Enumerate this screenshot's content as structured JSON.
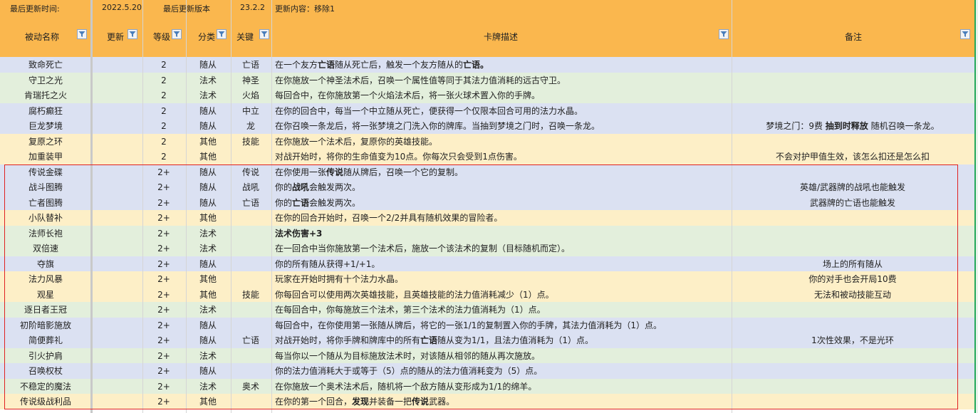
{
  "info": {
    "last_update_label": "最后更新时间:",
    "last_update_date": "2022.5.20",
    "last_version_label": "最后更新版本",
    "version": "23.2.2",
    "update_content": "更新内容：移除1"
  },
  "headers": {
    "name": "被动名称",
    "updated": "更新",
    "level": "等级",
    "category": "分类",
    "keyword": "关键",
    "description": "卡牌描述",
    "notes": "备注"
  },
  "colors": {
    "header": "#fab74e",
    "blue_row": "#dbe1f2",
    "green_row": "#e3efdc",
    "yellow_row": "#fdefc7",
    "highlight_border": "#e02020",
    "filter_icon": "#4a7ebb"
  },
  "rows": [
    {
      "name": "致命死亡",
      "level": "2",
      "category": "随从",
      "keyword": "亡语",
      "color": "blue",
      "desc": [
        [
          "在一个友方",
          false
        ],
        [
          "亡语",
          true
        ],
        [
          "随从死亡后，触发一个友方随从的",
          false
        ],
        [
          "亡语。",
          true
        ]
      ],
      "note": ""
    },
    {
      "name": "守卫之光",
      "level": "2",
      "category": "法术",
      "keyword": "神圣",
      "color": "green",
      "desc": [
        [
          "在你施放一个神圣法术后，召唤一个属性值等同于其法力值消耗的远古守卫。",
          false
        ]
      ],
      "note": ""
    },
    {
      "name": "肯瑞托之火",
      "level": "2",
      "category": "法术",
      "keyword": "火焰",
      "color": "green",
      "desc": [
        [
          "每回合中，在你施放第一个火焰法术后，将一张火球术置入你的手牌。",
          false
        ]
      ],
      "note": ""
    },
    {
      "name": "腐朽癫狂",
      "level": "2",
      "category": "随从",
      "keyword": "中立",
      "color": "blue",
      "desc": [
        [
          "在你的回合中，每当一个中立随从死亡，便获得一个仅限本回合可用的法力水晶。",
          false
        ]
      ],
      "note": ""
    },
    {
      "name": "巨龙梦境",
      "level": "2",
      "category": "随从",
      "keyword": "龙",
      "color": "blue",
      "desc": [
        [
          "在你召唤一条龙后，将一张梦境之门洗入你的牌库。当抽到梦境之门时，召唤一条龙。",
          false
        ]
      ],
      "note": [
        [
          "梦境之门：9费 ",
          false
        ],
        [
          "抽到时释放",
          true
        ],
        [
          " 随机召唤一条龙。",
          false
        ]
      ]
    },
    {
      "name": "复原之环",
      "level": "2",
      "category": "其他",
      "keyword": "技能",
      "color": "yellow",
      "desc": [
        [
          "在你施放一个法术后，复原你的英雄技能。",
          false
        ]
      ],
      "note": ""
    },
    {
      "name": "加重装甲",
      "level": "2",
      "category": "其他",
      "keyword": "",
      "color": "yellow",
      "desc": [
        [
          "对战开始时，将你的生命值变为10点。你每次只会受到1点伤害。",
          false
        ]
      ],
      "note": "不会对护甲值生效，该怎么扣还是怎么扣"
    },
    {
      "name": "传说金碟",
      "level": "2+",
      "category": "随从",
      "keyword": "传说",
      "color": "blue",
      "desc": [
        [
          "在你使用一张",
          false
        ],
        [
          "传说",
          true
        ],
        [
          "随从牌后，召唤一个它的复制。",
          false
        ]
      ],
      "note": ""
    },
    {
      "name": "战斗图腾",
      "level": "2+",
      "category": "随从",
      "keyword": "战吼",
      "color": "blue",
      "desc": [
        [
          "你的",
          false
        ],
        [
          "战吼",
          true
        ],
        [
          "会触发两次。",
          false
        ]
      ],
      "note": "英雄/武器牌的战吼也能触发"
    },
    {
      "name": "亡者图腾",
      "level": "2+",
      "category": "随从",
      "keyword": "亡语",
      "color": "blue",
      "desc": [
        [
          "你的",
          false
        ],
        [
          "亡语",
          true
        ],
        [
          "会触发两次。",
          false
        ]
      ],
      "note": "武器牌的亡语也能触发"
    },
    {
      "name": "小队替补",
      "level": "2+",
      "category": "其他",
      "keyword": "",
      "color": "yellow",
      "desc": [
        [
          "在你的回合开始时，召唤一个2/2并具有随机效果的冒险者。",
          false
        ]
      ],
      "note": ""
    },
    {
      "name": "法师长袍",
      "level": "2+",
      "category": "法术",
      "keyword": "",
      "color": "green",
      "desc": [
        [
          "法术伤害+3",
          true
        ]
      ],
      "note": ""
    },
    {
      "name": "双倍速",
      "level": "2+",
      "category": "法术",
      "keyword": "",
      "color": "green",
      "desc": [
        [
          "在一回合中当你施放第一个法术后，施放一个该法术的复制（目标随机而定）。",
          false
        ]
      ],
      "note": ""
    },
    {
      "name": "夺旗",
      "level": "2+",
      "category": "随从",
      "keyword": "",
      "color": "blue",
      "desc": [
        [
          "你的所有随从获得+1/+1。",
          false
        ]
      ],
      "note": "场上的所有随从"
    },
    {
      "name": "法力风暴",
      "level": "2+",
      "category": "其他",
      "keyword": "",
      "color": "yellow",
      "desc": [
        [
          "玩家在开始时拥有十个法力水晶。",
          false
        ]
      ],
      "note": "你的对手也会开局10费"
    },
    {
      "name": "观星",
      "level": "2+",
      "category": "其他",
      "keyword": "技能",
      "color": "yellow",
      "desc": [
        [
          "你每回合可以使用两次英雄技能，且英雄技能的法力值消耗减少（1）点。",
          false
        ]
      ],
      "note": "无法和被动技能互动"
    },
    {
      "name": "逐日者王冠",
      "level": "2+",
      "category": "法术",
      "keyword": "",
      "color": "green",
      "desc": [
        [
          "在每回合中，你每施放三个法术，第三个法术的法力值消耗为（1）点。",
          false
        ]
      ],
      "note": ""
    },
    {
      "name": "初阶暗影施放",
      "level": "2+",
      "category": "随从",
      "keyword": "",
      "color": "blue",
      "desc": [
        [
          "每回合中，在你使用第一张随从牌后，将它的一张1/1的复制置入你的手牌，其法力值消耗为（1）点。",
          false
        ]
      ],
      "note": ""
    },
    {
      "name": "简便葬礼",
      "level": "2+",
      "category": "随从",
      "keyword": "亡语",
      "color": "blue",
      "desc": [
        [
          "对战开始时，将你手牌和牌库中的所有",
          false
        ],
        [
          "亡语",
          true
        ],
        [
          "随从变为1/1，且法力值消耗为（1）点。",
          false
        ]
      ],
      "note": "1次性效果，不是光环"
    },
    {
      "name": "引火护肩",
      "level": "2+",
      "category": "法术",
      "keyword": "",
      "color": "green",
      "desc": [
        [
          "每当你以一个随从为目标施放法术时，对该随从相邻的随从再次施放。",
          false
        ]
      ],
      "note": ""
    },
    {
      "name": "召唤权杖",
      "level": "2+",
      "category": "随从",
      "keyword": "",
      "color": "blue",
      "desc": [
        [
          "你的法力值消耗大于或等于（5）点的随从的法力值消耗变为（5）点。",
          false
        ]
      ],
      "note": ""
    },
    {
      "name": "不稳定的魔法",
      "level": "2+",
      "category": "法术",
      "keyword": "奥术",
      "color": "green",
      "desc": [
        [
          "在你施放一个奥术法术后，随机将一个敌方随从变形成为1/1的绵羊。",
          false
        ]
      ],
      "note": ""
    },
    {
      "name": "传说级战利品",
      "level": "2+",
      "category": "其他",
      "keyword": "",
      "color": "yellow",
      "desc": [
        [
          "在你的第一个回合，",
          false
        ],
        [
          "发现",
          true
        ],
        [
          "并装备一把",
          false
        ],
        [
          "传说",
          true
        ],
        [
          "武器。",
          false
        ]
      ],
      "note": ""
    }
  ]
}
